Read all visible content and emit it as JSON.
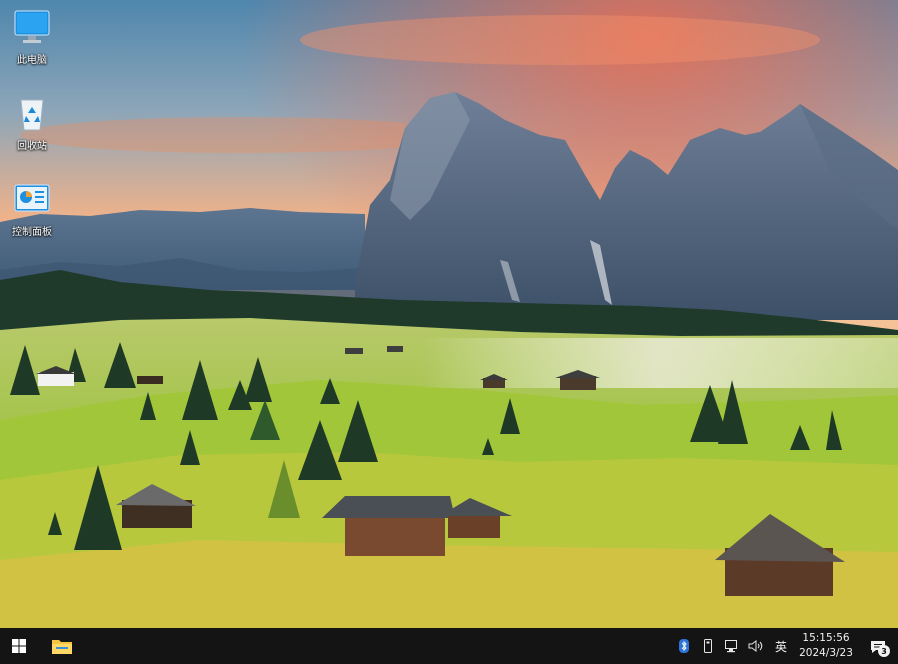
{
  "desktop": {
    "icons": [
      {
        "label": "此电脑",
        "icon": "this-pc-icon"
      },
      {
        "label": "回收站",
        "icon": "recycle-bin-icon"
      },
      {
        "label": "控制面板",
        "icon": "control-panel-icon"
      }
    ]
  },
  "taskbar": {
    "start_icon": "windows-logo-icon",
    "pinned": [
      {
        "name": "file-explorer",
        "icon": "folder-icon"
      }
    ],
    "tray": {
      "icons": [
        "bluetooth-icon",
        "usb-device-icon",
        "network-icon",
        "volume-icon"
      ],
      "ime": "英",
      "time": "15:15:56",
      "date": "2024/3/23",
      "notification_count": "3"
    }
  },
  "colors": {
    "taskbar": "#141414",
    "sky_top": "#4f7fa6",
    "sunset": "#f08a5a",
    "grass": "#9bc23a"
  }
}
